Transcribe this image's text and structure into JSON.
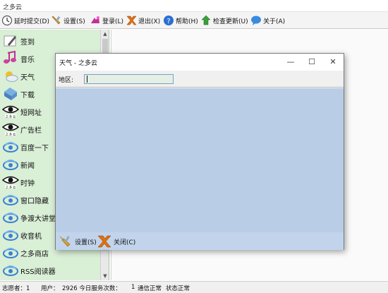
{
  "app": {
    "title": "之多云"
  },
  "toolbar": {
    "items": [
      {
        "label": "延时提交(D)",
        "icon": "clock-icon"
      },
      {
        "label": "设置(S)",
        "icon": "tools-icon"
      },
      {
        "label": "登录(L)",
        "icon": "login-icon"
      },
      {
        "label": "退出(X)",
        "icon": "exit-icon"
      },
      {
        "label": "帮助(H)",
        "icon": "help-icon"
      },
      {
        "label": "检查更新(U)",
        "icon": "update-icon"
      },
      {
        "label": "关于(A)",
        "icon": "about-icon"
      }
    ]
  },
  "sidebar": {
    "items": [
      {
        "label": "签到",
        "icon": "pen-icon"
      },
      {
        "label": "音乐",
        "icon": "music-icon"
      },
      {
        "label": "天气",
        "icon": "weather-icon"
      },
      {
        "label": "下载",
        "icon": "download-icon"
      },
      {
        "label": "短网址",
        "icon": "eye-logo-icon"
      },
      {
        "label": "广告栏",
        "icon": "eye-logo-icon"
      },
      {
        "label": "百度一下",
        "icon": "globe-icon"
      },
      {
        "label": "新闻",
        "icon": "globe-icon"
      },
      {
        "label": "时钟",
        "icon": "eye-logo-icon"
      },
      {
        "label": "窗口隐藏",
        "icon": "globe-icon"
      },
      {
        "label": "争渡大讲堂",
        "icon": "globe-icon"
      },
      {
        "label": "收音机",
        "icon": "globe-icon"
      },
      {
        "label": "之多商店",
        "icon": "globe-icon"
      },
      {
        "label": "RSS阅读器",
        "icon": "globe-icon"
      }
    ]
  },
  "status": {
    "volunteer": "志愿者：1",
    "users": "用户：",
    "served": "2926 今日服务次数：",
    "count": "1",
    "comm": "通信正常",
    "state": "状态正常"
  },
  "dialog": {
    "title": "天气 - 之多云",
    "region_label": "地区:",
    "region_value": "",
    "settings_label": "设置(S)",
    "close_label": "关闭(C)"
  },
  "colors": {
    "sidebar_bg": "#d9efd6",
    "dialog_body": "#b9cde6",
    "dialog_footer": "#c1d4ec"
  }
}
